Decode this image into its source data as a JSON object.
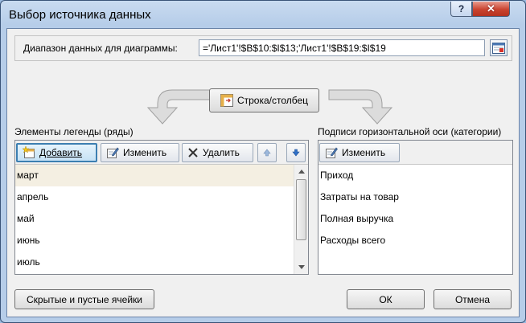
{
  "window": {
    "title": "Выбор источника данных",
    "help_label": "?",
    "close_label": "✕"
  },
  "range": {
    "label": "Диапазон данных для диаграммы:",
    "value": "='Лист1'!$B$10:$I$13;'Лист1'!$B$19:$I$19"
  },
  "switch_button": {
    "label": "Строка/столбец"
  },
  "legend": {
    "title": "Элементы легенды (ряды)",
    "add_label": "Добавить",
    "edit_label": "Изменить",
    "delete_label": "Удалить",
    "items": [
      "март",
      "апрель",
      "май",
      "июнь",
      "июль"
    ]
  },
  "axis": {
    "title": "Подписи горизонтальной оси (категории)",
    "edit_label": "Изменить",
    "items": [
      "Приход",
      "Затраты на товар",
      "Полная выручка",
      "Расходы всего"
    ]
  },
  "footer": {
    "hidden_cells_label": "Скрытые и пустые ячейки",
    "ok_label": "ОК",
    "cancel_label": "Отмена"
  },
  "colors": {
    "title_bar": "#b6cde9",
    "close_button": "#c9432f",
    "selected_row": "#f4efe2",
    "active_button_border": "#3c7fb1"
  },
  "icons": [
    "range-collapse-icon",
    "switch-row-column-icon",
    "add-series-icon",
    "edit-icon",
    "delete-x-icon",
    "move-up-icon",
    "move-down-icon",
    "scroll-up-icon",
    "scroll-down-icon",
    "curved-arrow-left-icon",
    "curved-arrow-right-icon"
  ]
}
